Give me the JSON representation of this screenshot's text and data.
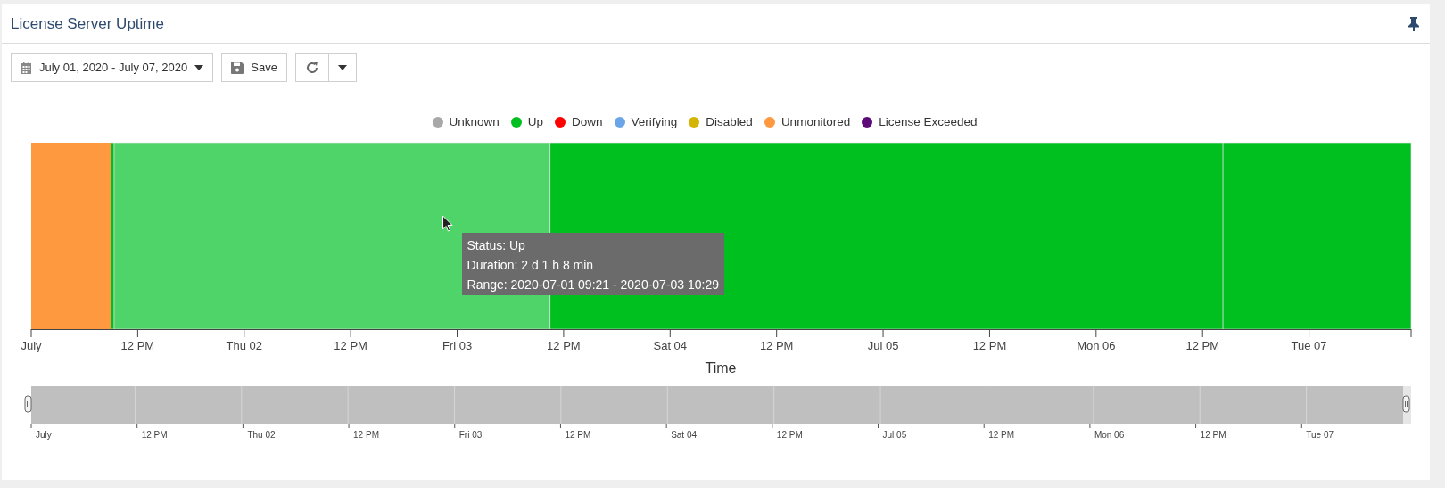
{
  "panel": {
    "title": "License Server Uptime"
  },
  "toolbar": {
    "date_range": "July 01, 2020 - July 07, 2020",
    "save": "Save"
  },
  "legend": [
    {
      "label": "Unknown",
      "color": "#a8a8a8"
    },
    {
      "label": "Up",
      "color": "#00c020"
    },
    {
      "label": "Down",
      "color": "#ff0000"
    },
    {
      "label": "Verifying",
      "color": "#6aa5e8"
    },
    {
      "label": "Disabled",
      "color": "#d4b400"
    },
    {
      "label": "Unmonitored",
      "color": "#ff9940"
    },
    {
      "label": "License Exceeded",
      "color": "#5c0a78"
    }
  ],
  "timeline": {
    "axis_title": "Time",
    "axis_labels": [
      "July",
      "12 PM",
      "Thu 02",
      "12 PM",
      "Fri 03",
      "12 PM",
      "Sat 04",
      "12 PM",
      "Jul 05",
      "12 PM",
      "Mon 06",
      "12 PM",
      "Tue 07"
    ],
    "segments": [
      {
        "color": "#ff9940"
      },
      {
        "color": "#00c020"
      },
      {
        "color": "#4fd46a"
      },
      {
        "color": "#00c020"
      },
      {
        "color": "#00c020"
      }
    ]
  },
  "tooltip": {
    "lines": [
      "Status: Up",
      "Duration: 2 d 1 h 8 min",
      "Range: 2020-07-01 09:21 - 2020-07-03 10:29"
    ]
  },
  "navigator": {
    "labels": [
      "July",
      "12 PM",
      "Thu 02",
      "12 PM",
      "Fri 03",
      "12 PM",
      "Sat 04",
      "12 PM",
      "Jul 05",
      "12 PM",
      "Mon 06",
      "12 PM",
      "Tue 07"
    ]
  }
}
